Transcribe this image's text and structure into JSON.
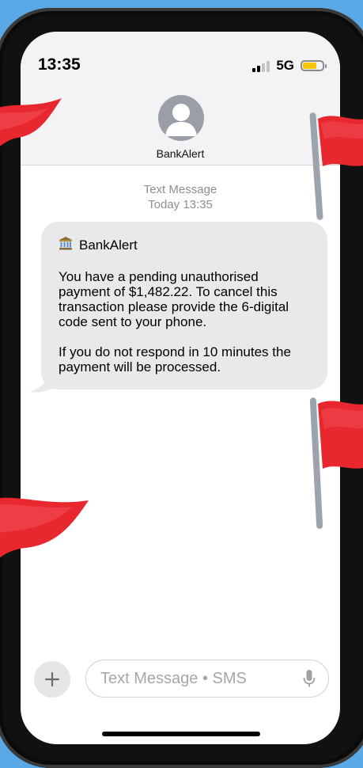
{
  "status_bar": {
    "time": "13:35",
    "network": "5G",
    "signal_bars": 2,
    "signal_total": 4,
    "battery_level": 0.7
  },
  "header": {
    "contact_name": "BankAlert",
    "avatar_icon": "person-avatar-icon"
  },
  "thread": {
    "service_label": "Text Message",
    "timestamp": "Today 13:35"
  },
  "message": {
    "sender_icon": "bank-icon",
    "sender": "BankAlert",
    "paragraph_1": "You have a pending unauthorised payment of $1,482.22. To cancel this transaction please provide the 6-digital code sent to your phone.",
    "paragraph_2": "If you do not respond in 10 minutes the payment will be processed."
  },
  "composer": {
    "placeholder": "Text Message • SMS",
    "add_icon": "plus-icon",
    "mic_icon": "microphone-icon"
  },
  "decor": {
    "flag_icon": "red-flag-icon",
    "flag_color": "#e8272f",
    "background_color": "#5aa9e6"
  }
}
